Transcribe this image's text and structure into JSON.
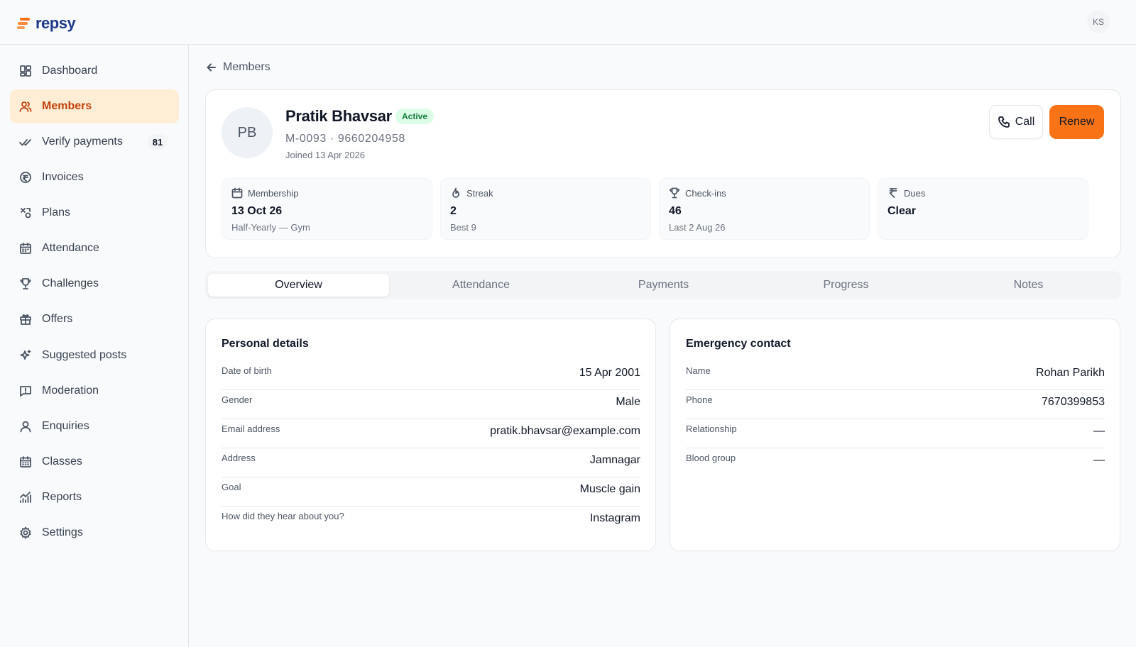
{
  "brand": {
    "name": "repsy",
    "colors": {
      "accent": "#f97316",
      "brand_text": "#1e3a8a"
    }
  },
  "user": {
    "initials": "KS"
  },
  "sidebar": {
    "items": [
      {
        "label": "Dashboard",
        "icon": "dashboard-icon"
      },
      {
        "label": "Members",
        "icon": "users-icon",
        "active": true
      },
      {
        "label": "Verify payments",
        "icon": "check-double-icon",
        "badge": "81"
      },
      {
        "label": "Invoices",
        "icon": "invoice-coin-icon"
      },
      {
        "label": "Plans",
        "icon": "plans-icon"
      },
      {
        "label": "Attendance",
        "icon": "calendar-icon"
      },
      {
        "label": "Challenges",
        "icon": "trophy-icon"
      },
      {
        "label": "Offers",
        "icon": "gift-icon"
      },
      {
        "label": "Suggested posts",
        "icon": "sparkles-icon"
      },
      {
        "label": "Moderation",
        "icon": "message-alert-icon"
      },
      {
        "label": "Enquiries",
        "icon": "user-icon"
      },
      {
        "label": "Classes",
        "icon": "calendar-grid-icon"
      },
      {
        "label": "Reports",
        "icon": "chart-icon"
      },
      {
        "label": "Settings",
        "icon": "gear-icon"
      }
    ]
  },
  "breadcrumb": {
    "back_label": "Members"
  },
  "member": {
    "initials": "PB",
    "name": "Pratik Bhavsar",
    "status": "Active",
    "meta": "M-0093 · 9660204958",
    "joined": "Joined 13 Apr 2026"
  },
  "actions": {
    "call_label": "Call",
    "renew_label": "Renew"
  },
  "stats": [
    {
      "label": "Membership",
      "value": "13 Oct 26",
      "sub": "Half-Yearly — Gym",
      "icon": "calendar-icon"
    },
    {
      "label": "Streak",
      "value": "2",
      "sub": "Best 9",
      "icon": "flame-icon"
    },
    {
      "label": "Check-ins",
      "value": "46",
      "sub": "Last 2 Aug 26",
      "icon": "trophy-icon"
    },
    {
      "label": "Dues",
      "value": "Clear",
      "sub": "",
      "icon": "rupee-icon"
    }
  ],
  "tabs": [
    {
      "label": "Overview",
      "active": true
    },
    {
      "label": "Attendance"
    },
    {
      "label": "Payments"
    },
    {
      "label": "Progress"
    },
    {
      "label": "Notes"
    }
  ],
  "personal": {
    "title": "Personal details",
    "rows": [
      {
        "label": "Date of birth",
        "value": "15 Apr 2001"
      },
      {
        "label": "Gender",
        "value": "Male"
      },
      {
        "label": "Email address",
        "value": "pratik.bhavsar@example.com"
      },
      {
        "label": "Address",
        "value": "Jamnagar"
      },
      {
        "label": "Goal",
        "value": "Muscle gain"
      },
      {
        "label": "How did they hear about you?",
        "value": "Instagram"
      }
    ]
  },
  "emergency": {
    "title": "Emergency contact",
    "rows": [
      {
        "label": "Name",
        "value": "Rohan Parikh"
      },
      {
        "label": "Phone",
        "value": "7670399853"
      },
      {
        "label": "Relationship",
        "value": "—"
      },
      {
        "label": "Blood group",
        "value": "—"
      }
    ]
  }
}
